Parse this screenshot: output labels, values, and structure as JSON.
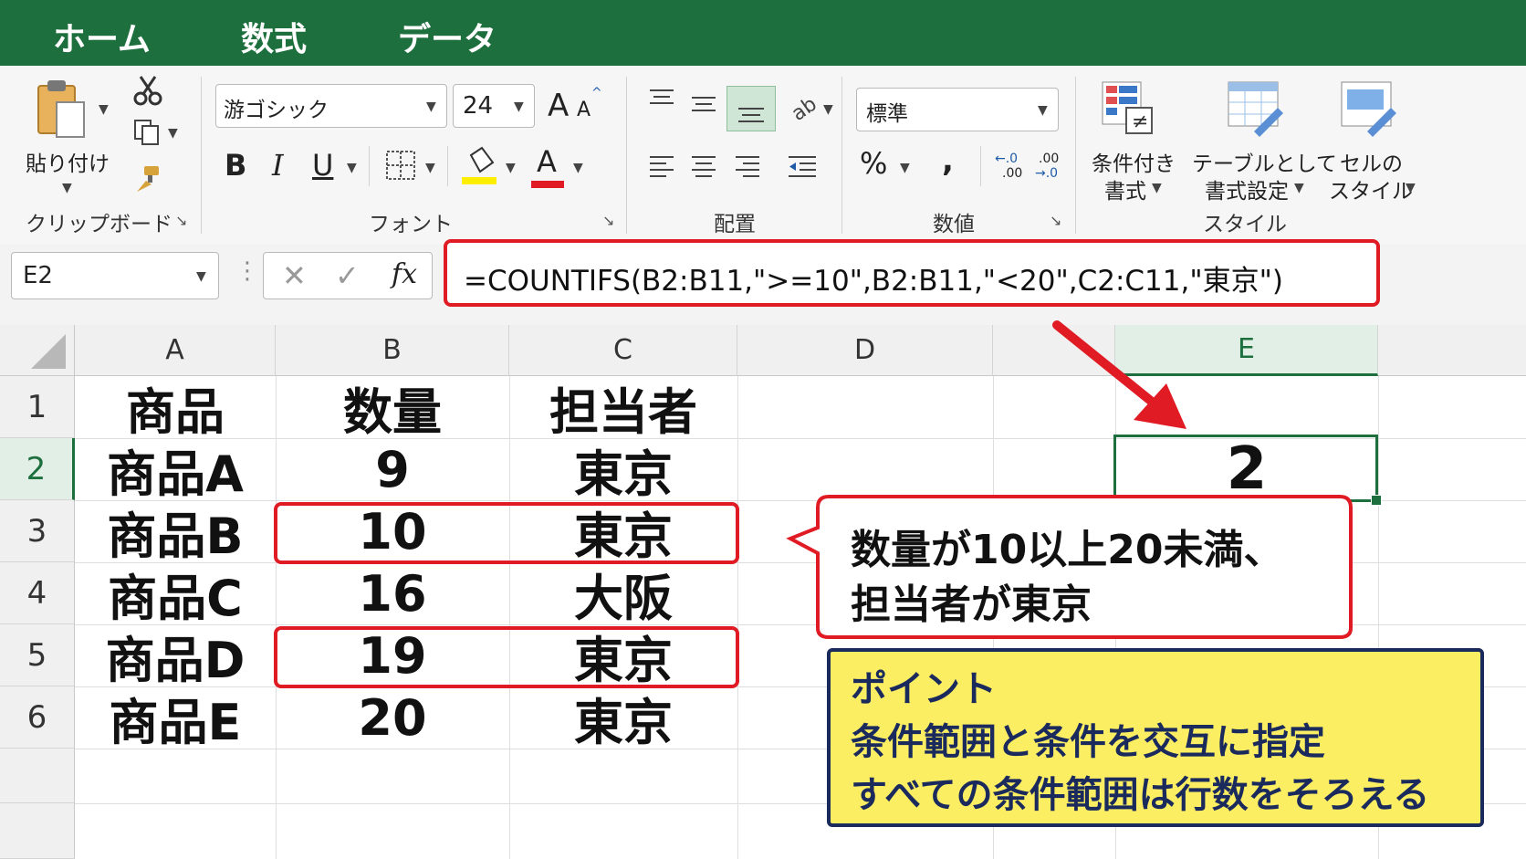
{
  "tabs": [
    "ホーム",
    "数式",
    "データ"
  ],
  "ribbon": {
    "clipboard": {
      "paste_label": "貼り付け",
      "group_label": "クリップボード"
    },
    "font": {
      "font_name": "游ゴシック",
      "font_size": "24",
      "bold": "B",
      "italic": "I",
      "underline": "U",
      "font_color_glyph": "A",
      "grow_glyph": "A",
      "shrink_glyph": "A",
      "group_label": "フォント"
    },
    "alignment": {
      "group_label": "配置"
    },
    "number": {
      "format": "標準",
      "percent": "%",
      "comma": ",",
      "inc_decimal_top": "←.0",
      "inc_decimal_bottom": ".00",
      "dec_decimal_top": ".00",
      "dec_decimal_bottom": "→.0",
      "group_label": "数値"
    },
    "styles": {
      "conditional_line1": "条件付き",
      "conditional_line2": "書式",
      "table_line1": "テーブルとして",
      "table_line2": "書式設定",
      "cell_line1": "セルの",
      "cell_line2": "スタイル",
      "group_label": "スタイル"
    }
  },
  "formula_bar": {
    "name_box": "E2",
    "fx": "fx",
    "formula": "=COUNTIFS(B2:B11,\">=10\",B2:B11,\"<20\",C2:C11,\"東京\")"
  },
  "sheet": {
    "columns": [
      "A",
      "B",
      "C",
      "D",
      "E"
    ],
    "row_numbers": [
      "1",
      "2",
      "3",
      "4",
      "5",
      "6"
    ],
    "rows": [
      [
        "商品",
        "数量",
        "担当者",
        "",
        ""
      ],
      [
        "商品A",
        "9",
        "東京",
        "",
        "2"
      ],
      [
        "商品B",
        "10",
        "東京",
        "",
        ""
      ],
      [
        "商品C",
        "16",
        "大阪",
        "",
        ""
      ],
      [
        "商品D",
        "19",
        "東京",
        "",
        ""
      ],
      [
        "商品E",
        "20",
        "東京",
        "",
        ""
      ]
    ],
    "selected_cell": "E2"
  },
  "callout": {
    "line1": "数量が10以上20未満、",
    "line2": "担当者が東京"
  },
  "point_box": {
    "title": "ポイント",
    "line1": "条件範囲と条件を交互に指定",
    "line2": "すべての条件範囲は行数をそろえる"
  },
  "colors": {
    "excel_green": "#1e6f3e",
    "highlight_red": "#e01b24",
    "note_yellow": "#fbee63",
    "note_border": "#1b2a5c"
  }
}
